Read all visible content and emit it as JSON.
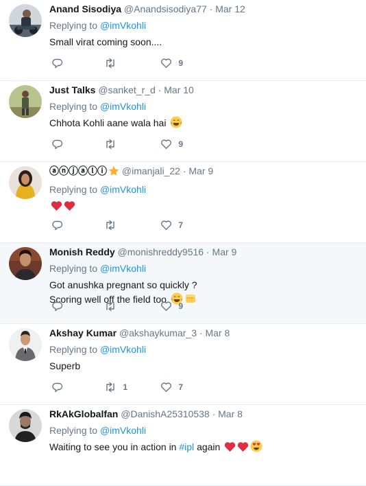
{
  "tweets": [
    {
      "name": "Anand Sisodiya",
      "handle": "@Anandsisodiya77",
      "time": "Mar 12",
      "replying_prefix": "Replying to",
      "replying_to": "@imVkohli",
      "lines": [
        "Small virat coming soon...."
      ],
      "retweets": "",
      "likes": "9",
      "highlighted": false
    },
    {
      "name": "Just Talks",
      "handle": "@sanket_r_d",
      "time": "Mar 10",
      "replying_prefix": "Replying to",
      "replying_to": "@imVkohli",
      "lines": [
        "Chhota Kohli aane wala hai"
      ],
      "retweets": "",
      "likes": "9",
      "highlighted": false
    },
    {
      "name": "ⓐⓝⓙⓐⓛⓘ",
      "handle": "@imanjali_22",
      "time": "Mar 9",
      "replying_prefix": "Replying to",
      "replying_to": "@imVkohli",
      "lines": [
        ""
      ],
      "retweets": "",
      "likes": "7",
      "highlighted": false
    },
    {
      "name": "Monish Reddy",
      "handle": "@monishreddy9516",
      "time": "Mar 9",
      "replying_prefix": "Replying to",
      "replying_to": "@imVkohli",
      "lines": [
        "Got anushka pregnant so quickly ?",
        "Scoring well off the field too"
      ],
      "retweets": "",
      "likes": "9",
      "highlighted": true
    },
    {
      "name": "Akshay Kumar",
      "handle": "@akshaykumar_3",
      "time": "Mar 8",
      "replying_prefix": "Replying to",
      "replying_to": "@imVkohli",
      "lines": [
        "Superb"
      ],
      "retweets": "1",
      "likes": "7",
      "highlighted": false
    },
    {
      "name": "RkAkGlobalfan",
      "handle": "@DanishA25310538",
      "time": "Mar 8",
      "replying_prefix": "Replying to",
      "replying_to": "@imVkohli",
      "lines": [
        "Waiting to see you in action in",
        "#ipl",
        "again"
      ],
      "retweets": "",
      "likes": "",
      "highlighted": false
    }
  ],
  "separator": "·",
  "colors": {
    "link": "#1b95e0",
    "muted": "#657786",
    "text": "#14171a",
    "highlight_bg": "#f5f8fa",
    "heart": "#e0245e",
    "star": "#ffac33"
  },
  "icons": {
    "reply": "reply-icon",
    "retweet": "retweet-icon",
    "like": "heart-outline-icon"
  }
}
